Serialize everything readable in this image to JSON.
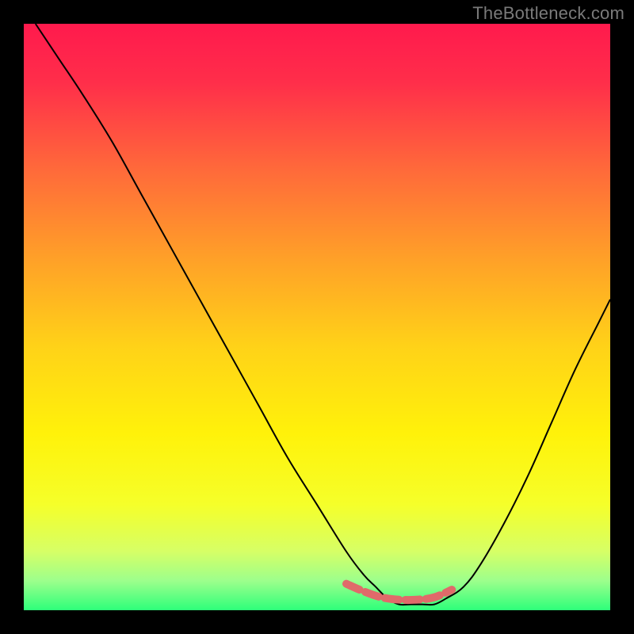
{
  "watermark": "TheBottleneck.com",
  "chart_data": {
    "type": "line",
    "title": "",
    "xlabel": "",
    "ylabel": "",
    "xlim": [
      0,
      100
    ],
    "ylim": [
      0,
      100
    ],
    "gradient_stops": [
      {
        "offset": 0.0,
        "color": "#ff1a4d"
      },
      {
        "offset": 0.1,
        "color": "#ff2e4a"
      },
      {
        "offset": 0.25,
        "color": "#ff6a3a"
      },
      {
        "offset": 0.4,
        "color": "#ffa028"
      },
      {
        "offset": 0.55,
        "color": "#ffd218"
      },
      {
        "offset": 0.7,
        "color": "#fff20a"
      },
      {
        "offset": 0.82,
        "color": "#f5ff2a"
      },
      {
        "offset": 0.9,
        "color": "#d6ff66"
      },
      {
        "offset": 0.95,
        "color": "#9cff8c"
      },
      {
        "offset": 1.0,
        "color": "#2dff7a"
      }
    ],
    "series": [
      {
        "name": "bottleneck-curve",
        "color": "#000000",
        "width": 2,
        "x": [
          2,
          6,
          10,
          15,
          20,
          25,
          30,
          35,
          40,
          45,
          50,
          55,
          58,
          60,
          62,
          64,
          66,
          68,
          70,
          72,
          75,
          78,
          82,
          86,
          90,
          94,
          98,
          100
        ],
        "y": [
          100,
          94,
          88,
          80,
          71,
          62,
          53,
          44,
          35,
          26,
          18,
          10,
          6,
          4,
          2,
          1,
          1,
          1,
          1,
          2,
          4,
          8,
          15,
          23,
          32,
          41,
          49,
          53
        ]
      },
      {
        "name": "marker-band",
        "color": "#e06a6a",
        "width": 10,
        "linecap": "round",
        "dash": "18 8",
        "x": [
          55,
          58,
          61,
          64,
          67,
          70,
          73
        ],
        "y": [
          4.5,
          3.2,
          2.2,
          1.8,
          1.8,
          2.2,
          3.5
        ]
      }
    ]
  }
}
